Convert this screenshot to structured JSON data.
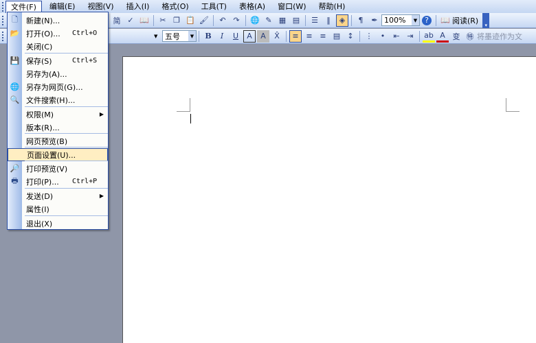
{
  "menubar": {
    "items": [
      "文件(F)",
      "编辑(E)",
      "视图(V)",
      "插入(I)",
      "格式(O)",
      "工具(T)",
      "表格(A)",
      "窗口(W)",
      "帮助(H)"
    ]
  },
  "toolbar": {
    "zoom": "100%",
    "read_label": "阅读(R)"
  },
  "format_toolbar": {
    "font_size": "五号",
    "reveal_text": "将墨迹作为文"
  },
  "file_menu": {
    "items": [
      {
        "label": "新建(N)...",
        "icon": "new-document-icon"
      },
      {
        "label": "打开(O)...",
        "shortcut": "Ctrl+O",
        "icon": "open-folder-icon"
      },
      {
        "label": "关闭(C)"
      },
      {
        "label": "保存(S)",
        "shortcut": "Ctrl+S",
        "icon": "save-icon"
      },
      {
        "label": "另存为(A)..."
      },
      {
        "label": "另存为网页(G)...",
        "icon": "save-web-icon"
      },
      {
        "label": "文件搜索(H)...",
        "icon": "file-search-icon"
      },
      {
        "label": "权限(M)",
        "submenu": true
      },
      {
        "label": "版本(R)..."
      },
      {
        "label": "网页预览(B)"
      },
      {
        "label": "页面设置(U)...",
        "highlighted": true
      },
      {
        "label": "打印预览(V)",
        "icon": "print-preview-icon"
      },
      {
        "label": "打印(P)...",
        "shortcut": "Ctrl+P",
        "icon": "print-icon"
      },
      {
        "label": "发送(D)",
        "submenu": true
      },
      {
        "label": "属性(I)"
      },
      {
        "label": "退出(X)"
      }
    ]
  },
  "colors": {
    "highlight": "#ffeec2",
    "menu_border": "#2a4ea5"
  }
}
